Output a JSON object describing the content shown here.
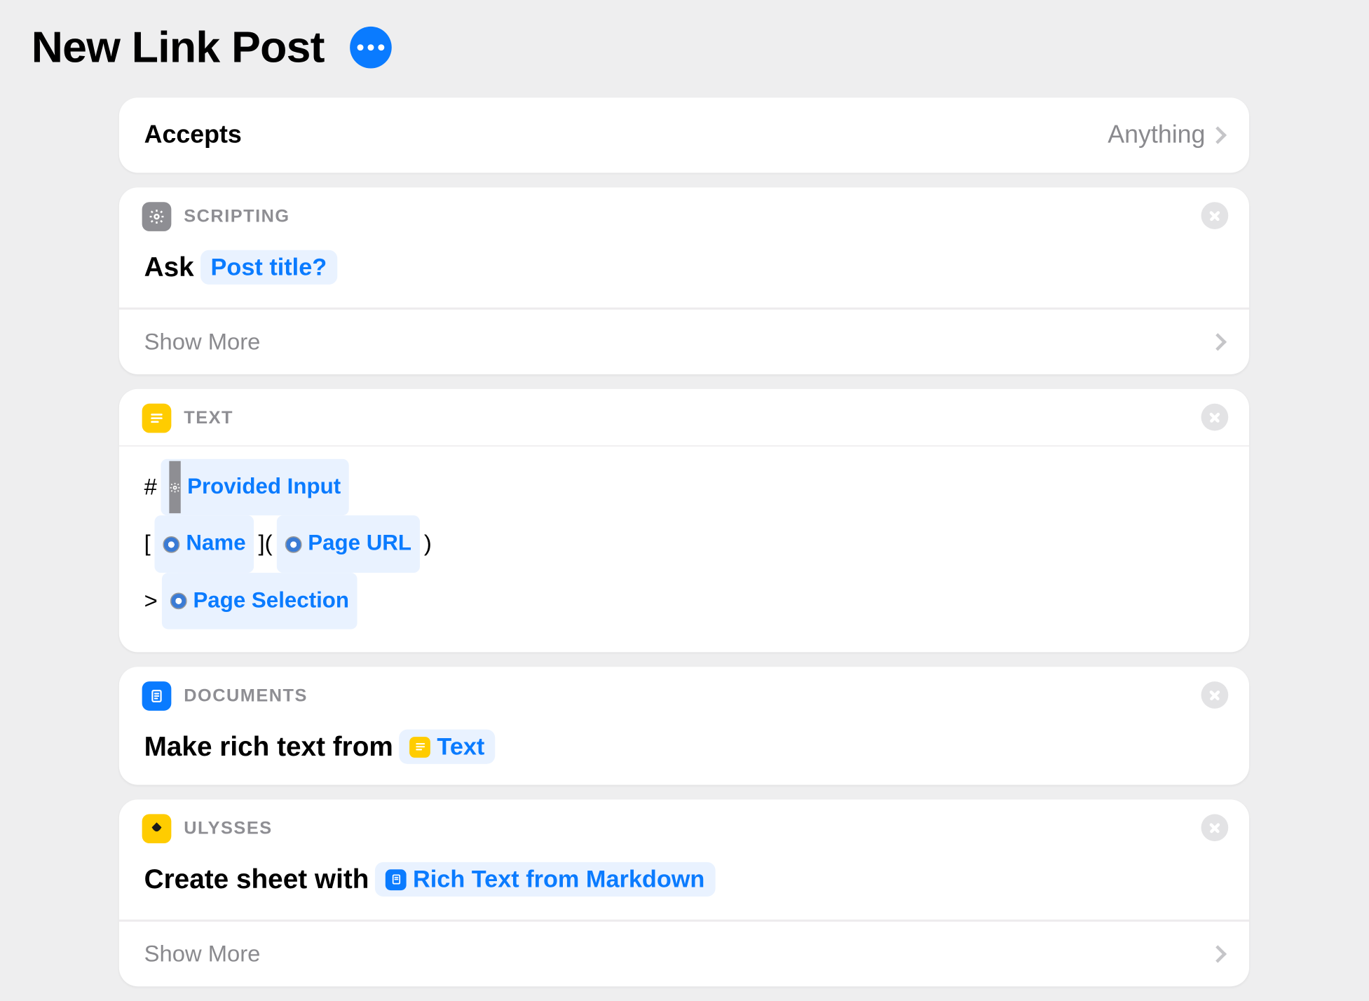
{
  "title": "New Link Post",
  "accepts": {
    "label": "Accepts",
    "value": "Anything"
  },
  "show_more": "Show More",
  "actions": [
    {
      "category": "SCRIPTING",
      "icon": "gear",
      "prefix": "Ask",
      "pill": {
        "label": "Post title?"
      },
      "show_more": true
    },
    {
      "category": "TEXT",
      "icon": "text",
      "text_lines": [
        {
          "frags": [
            {
              "t": "plain",
              "v": "# "
            },
            {
              "t": "pill",
              "icon": "gear",
              "v": "Provided Input"
            }
          ]
        },
        {
          "frags": [
            {
              "t": "plain",
              "v": "[ "
            },
            {
              "t": "pill",
              "icon": "safari",
              "v": "Name"
            },
            {
              "t": "plain",
              "v": " ]( "
            },
            {
              "t": "pill",
              "icon": "safari",
              "v": "Page URL"
            },
            {
              "t": "plain",
              "v": " )"
            }
          ]
        },
        {
          "frags": [
            {
              "t": "plain",
              "v": "> "
            },
            {
              "t": "pill",
              "icon": "safari",
              "v": "Page Selection"
            }
          ]
        }
      ]
    },
    {
      "category": "DOCUMENTS",
      "icon": "docs",
      "prefix": "Make rich text from",
      "pill": {
        "icon": "text",
        "label": "Text"
      }
    },
    {
      "category": "ULYSSES",
      "icon": "ulysses",
      "prefix": "Create sheet with",
      "pill": {
        "icon": "docs",
        "label": "Rich Text from Markdown"
      },
      "show_more": true
    }
  ]
}
